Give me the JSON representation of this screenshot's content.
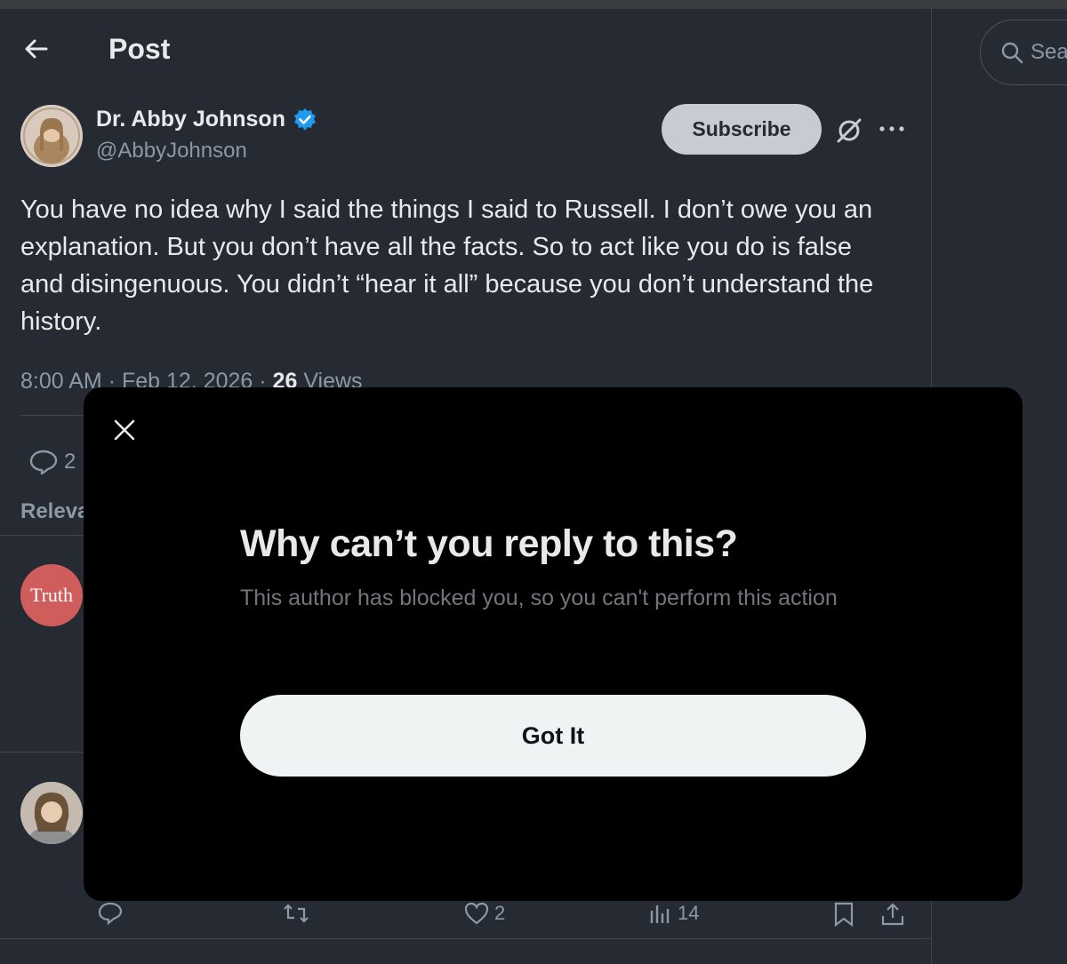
{
  "header": {
    "title": "Post"
  },
  "post": {
    "author_name": "Dr. Abby Johnson",
    "author_handle": "@AbbyJohnson",
    "subscribe_label": "Subscribe",
    "text": "You have no idea why I said the things I said to Russell. I don’t owe you an explanation. But you don’t have all the facts. So to act like you do is false and disingenuous. You didn’t “hear it all” because you don’t understand the history.",
    "time": "8:00 AM",
    "date": "Feb 12, 2026",
    "views_count": "26",
    "views_label": "Views",
    "reply_count": "2"
  },
  "replies_section": {
    "sort_label": "Releva",
    "truth_avatar_text": "Truth"
  },
  "reply_actions": {
    "likes": "2",
    "views": "14"
  },
  "search": {
    "placeholder": "Sea"
  },
  "modal": {
    "title": "Why can’t you reply to this?",
    "body": "This author has blocked you, so you can't perform this action",
    "button_label": "Got It"
  },
  "colors": {
    "background": "#252a33",
    "modal_background": "#000000",
    "verified_blue": "#1d9bf0",
    "secondary_text": "#8b98a5"
  }
}
